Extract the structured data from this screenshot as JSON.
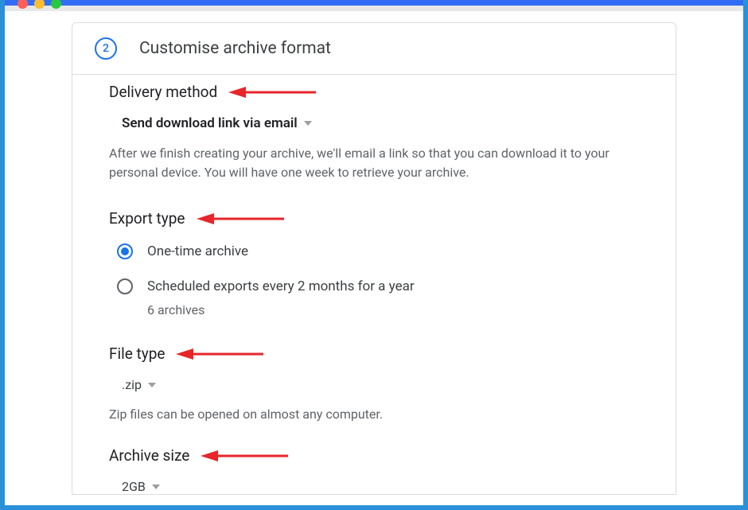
{
  "step": {
    "number": "2",
    "title": "Customise archive format"
  },
  "delivery": {
    "label": "Delivery method",
    "selected": "Send download link via email",
    "help": "After we finish creating your archive, we'll email a link so that you can download it to your personal device. You will have one week to retrieve your archive."
  },
  "export": {
    "label": "Export type",
    "option1": "One-time archive",
    "option2": "Scheduled exports every 2 months for a year",
    "option2_sub": "6 archives"
  },
  "filetype": {
    "label": "File type",
    "selected": ".zip",
    "help": "Zip files can be opened on almost any computer."
  },
  "archivesize": {
    "label": "Archive size",
    "selected": "2GB"
  }
}
